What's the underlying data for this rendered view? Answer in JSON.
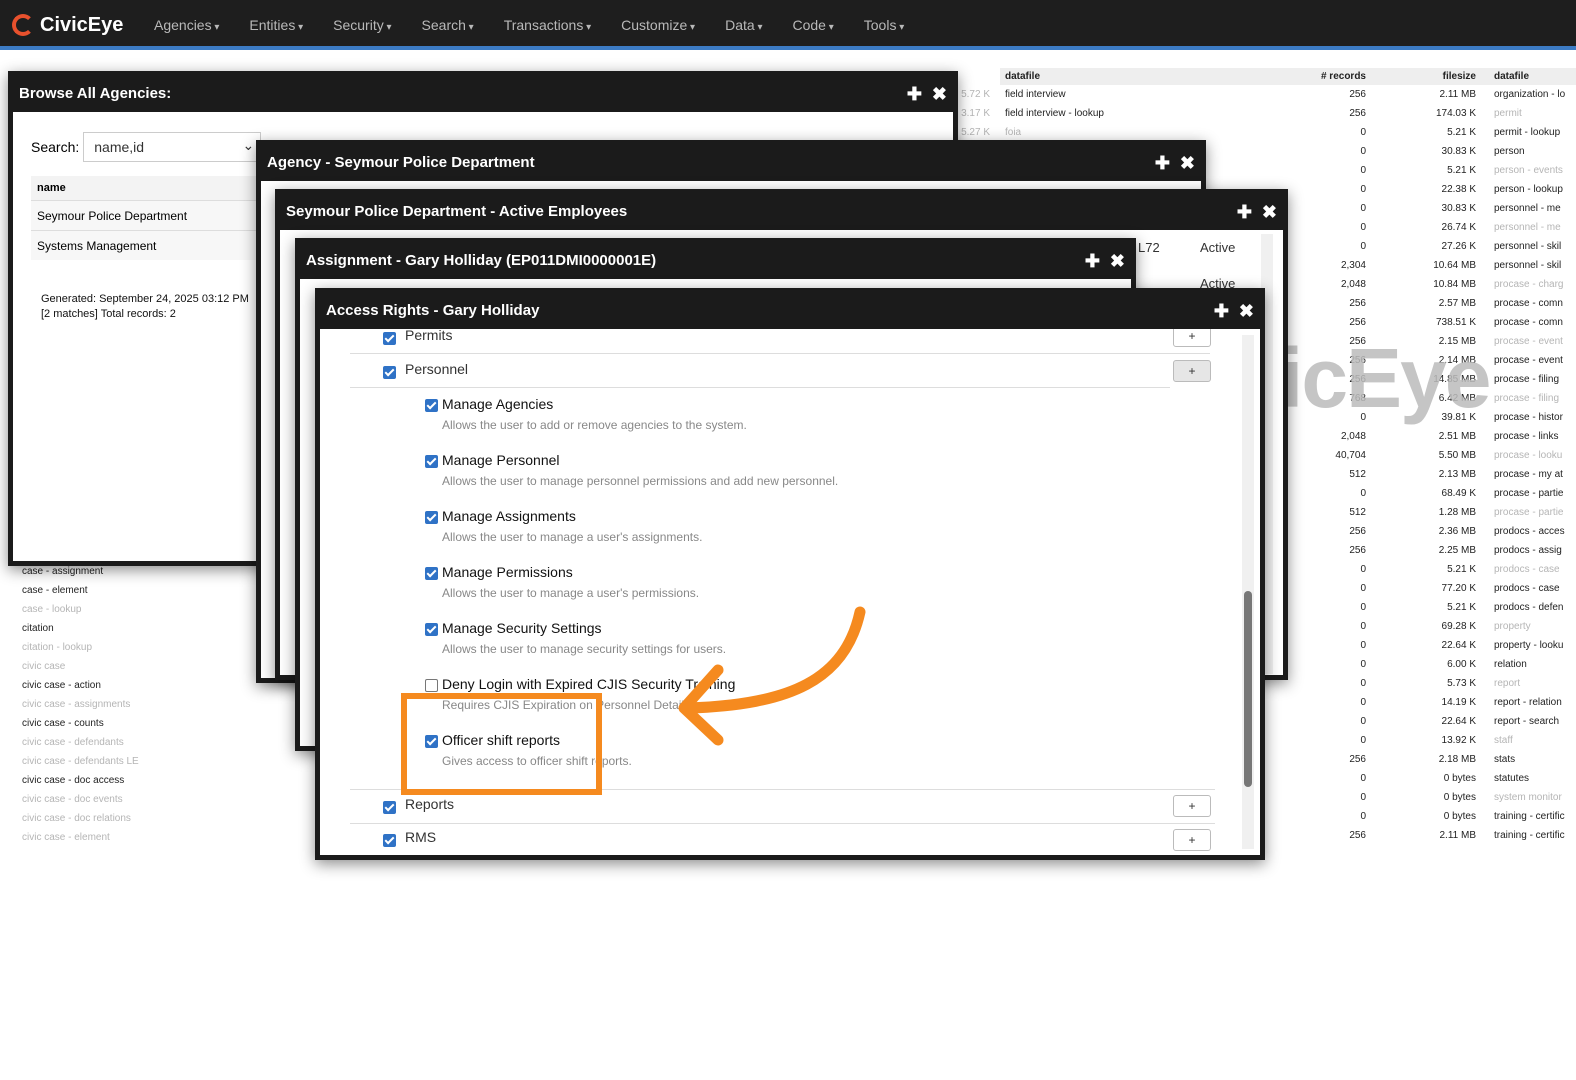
{
  "navbar": {
    "brand": "CivicEye",
    "menu": [
      "Agencies",
      "Entities",
      "Security",
      "Search",
      "Transactions",
      "Customize",
      "Data",
      "Code",
      "Tools"
    ]
  },
  "background_left_list": [
    {
      "label": "case - assignment",
      "dim": false
    },
    {
      "label": "case - element",
      "dim": false
    },
    {
      "label": "case - lookup",
      "dim": true
    },
    {
      "label": "citation",
      "dim": false
    },
    {
      "label": "citation - lookup",
      "dim": true
    },
    {
      "label": "civic case",
      "dim": true
    },
    {
      "label": "civic case - action",
      "dim": false
    },
    {
      "label": "civic case - assignments",
      "dim": true
    },
    {
      "label": "civic case - counts",
      "dim": false
    },
    {
      "label": "civic case - defendants",
      "dim": true
    },
    {
      "label": "civic case - defendants LE",
      "dim": true
    },
    {
      "label": "civic case - doc access",
      "dim": false
    },
    {
      "label": "civic case - doc events",
      "dim": true
    },
    {
      "label": "civic case - doc relations",
      "dim": true
    },
    {
      "label": "civic case - element",
      "dim": true
    }
  ],
  "background_mid_sizes": [
    "5.72 K",
    "3.17 K",
    "5.27 K"
  ],
  "background_table": {
    "headers": [
      "datafile",
      "# records",
      "filesize",
      "datafile"
    ],
    "rows": [
      [
        "field interview",
        "256",
        "2.11 MB",
        "organization - lo"
      ],
      [
        "field interview - lookup",
        "256",
        "174.03 K",
        "permit"
      ],
      [
        "foia",
        "0",
        "5.21 K",
        "permit - lookup"
      ],
      [
        "",
        "0",
        "30.83 K",
        "person"
      ],
      [
        "",
        "0",
        "5.21 K",
        "person - events"
      ],
      [
        "",
        "0",
        "22.38 K",
        "person - lookup"
      ],
      [
        "",
        "0",
        "30.83 K",
        "personnel - me"
      ],
      [
        "",
        "0",
        "26.74 K",
        "personnel - me"
      ],
      [
        "",
        "0",
        "27.26 K",
        "personnel - skil"
      ],
      [
        "",
        "2,304",
        "10.64 MB",
        "personnel - skil"
      ],
      [
        "",
        "2,048",
        "10.84 MB",
        "procase - charg"
      ],
      [
        "",
        "256",
        "2.57 MB",
        "procase - comn"
      ],
      [
        "",
        "256",
        "738.51 K",
        "procase - comn"
      ],
      [
        "",
        "256",
        "2.15 MB",
        "procase - event"
      ],
      [
        "",
        "256",
        "2.14 MB",
        "procase - event"
      ],
      [
        "",
        "256",
        "14.85 MB",
        "procase - filing"
      ],
      [
        "",
        "768",
        "6.42 MB",
        "procase - filing"
      ],
      [
        "",
        "0",
        "39.81 K",
        "procase - histor"
      ],
      [
        "",
        "2,048",
        "2.51 MB",
        "procase - links"
      ],
      [
        "",
        "40,704",
        "5.50 MB",
        "procase - looku"
      ],
      [
        "",
        "512",
        "2.13 MB",
        "procase - my at"
      ],
      [
        "",
        "0",
        "68.49 K",
        "procase - partie"
      ],
      [
        "",
        "512",
        "1.28 MB",
        "procase - partie"
      ],
      [
        "",
        "256",
        "2.36 MB",
        "prodocs - acces"
      ],
      [
        "",
        "256",
        "2.25 MB",
        "prodocs - assig"
      ],
      [
        "",
        "0",
        "5.21 K",
        "prodocs - case"
      ],
      [
        "",
        "0",
        "77.20 K",
        "prodocs - case"
      ],
      [
        "",
        "0",
        "5.21 K",
        "prodocs - defen"
      ],
      [
        "",
        "0",
        "69.28 K",
        "property"
      ],
      [
        "",
        "0",
        "22.64 K",
        "property - looku"
      ],
      [
        "",
        "0",
        "6.00 K",
        "relation"
      ],
      [
        "",
        "0",
        "5.73 K",
        "report"
      ],
      [
        "",
        "0",
        "14.19 K",
        "report - relation"
      ],
      [
        "",
        "0",
        "22.64 K",
        "report - search"
      ],
      [
        "",
        "0",
        "13.92 K",
        "staff"
      ],
      [
        "",
        "256",
        "2.18 MB",
        "stats"
      ],
      [
        "",
        "0",
        "0 bytes",
        "statutes"
      ],
      [
        "",
        "0",
        "0 bytes",
        "system monitor"
      ],
      [
        "",
        "0",
        "0 bytes",
        "training - certific"
      ],
      [
        "",
        "256",
        "2.11 MB",
        "training - certific"
      ]
    ]
  },
  "watermark": "icEye",
  "browse_window": {
    "title": "Browse All Agencies:",
    "search_label": "Search:",
    "search_field": "name,id",
    "table_header": "name",
    "rows": [
      "Seymour Police Department",
      "Systems Management"
    ],
    "generated": "Generated: September 24, 2025 03:12 PM",
    "matches": "[2 matches] Total records: 2"
  },
  "agency_window": {
    "title": "Agency - Seymour Police Department"
  },
  "employees_window": {
    "title": "Seymour Police Department - Active Employees",
    "visible_cells": [
      "L72",
      "Active",
      "Active"
    ]
  },
  "assignment_window": {
    "title": "Assignment - Gary Holliday (EP011DMI0000001E)"
  },
  "access_window": {
    "title": "Access Rights - Gary Holliday",
    "groups": {
      "permits": "Permits",
      "personnel": "Personnel",
      "reports": "Reports",
      "rms": "RMS"
    },
    "permissions": [
      {
        "title": "Manage Agencies",
        "desc": "Allows the user to add or remove agencies to the system.",
        "checked": true
      },
      {
        "title": "Manage Personnel",
        "desc": "Allows the user to manage personnel permissions and add new personnel.",
        "checked": true
      },
      {
        "title": "Manage Assignments",
        "desc": "Allows the user to manage a user's assignments.",
        "checked": true
      },
      {
        "title": "Manage Permissions",
        "desc": "Allows the user to manage a user's permissions.",
        "checked": true
      },
      {
        "title": "Manage Security Settings",
        "desc": "Allows the user to manage security settings for users.",
        "checked": true
      },
      {
        "title": "Deny Login with Expired CJIS Security Training",
        "desc": "Requires CJIS Expiration on Personnel Details.",
        "checked": false
      },
      {
        "title": "Officer shift reports",
        "desc": "Gives access to officer shift reports.",
        "checked": true
      }
    ],
    "plus_label": "+"
  },
  "annotation": {
    "color": "#f58a1f"
  },
  "colors": {
    "navbar": "#1e1e1e",
    "accent": "#3c7bc4",
    "checkbox": "#2f72c6",
    "brand": "#e8512d"
  }
}
